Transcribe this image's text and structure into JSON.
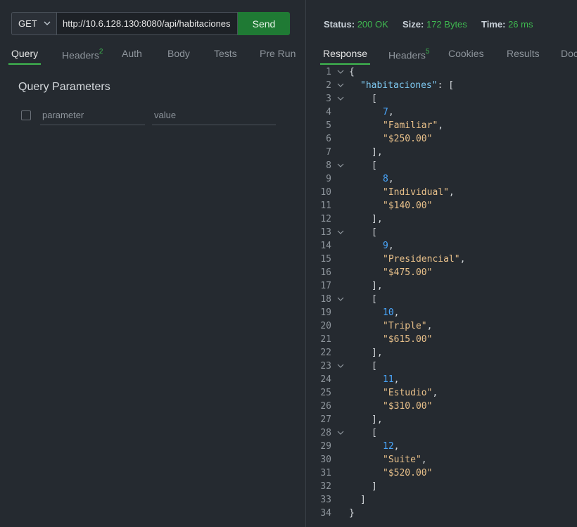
{
  "request": {
    "method": "GET",
    "url": "http://10.6.128.130:8080/api/habitaciones",
    "send_label": "Send"
  },
  "left_tabs": [
    {
      "label": "Query",
      "badge": ""
    },
    {
      "label": "Headers",
      "badge": "2"
    },
    {
      "label": "Auth",
      "badge": ""
    },
    {
      "label": "Body",
      "badge": ""
    },
    {
      "label": "Tests",
      "badge": ""
    },
    {
      "label": "Pre Run",
      "badge": ""
    }
  ],
  "query": {
    "title": "Query Parameters",
    "param_placeholder": "parameter",
    "value_placeholder": "value"
  },
  "status": {
    "status_label": "Status:",
    "status_value": "200 OK",
    "size_label": "Size:",
    "size_value": "172 Bytes",
    "time_label": "Time:",
    "time_value": "26 ms"
  },
  "right_tabs": [
    {
      "label": "Response",
      "badge": ""
    },
    {
      "label": "Headers",
      "badge": "5"
    },
    {
      "label": "Cookies",
      "badge": ""
    },
    {
      "label": "Results",
      "badge": ""
    },
    {
      "label": "Docs",
      "badge": ""
    }
  ],
  "response": {
    "key": "habitaciones",
    "rooms": [
      {
        "id": 7,
        "type": "Familiar",
        "price": "$250.00"
      },
      {
        "id": 8,
        "type": "Individual",
        "price": "$140.00"
      },
      {
        "id": 9,
        "type": "Presidencial",
        "price": "$475.00"
      },
      {
        "id": 10,
        "type": "Triple",
        "price": "$615.00"
      },
      {
        "id": 11,
        "type": "Estudio",
        "price": "$310.00"
      },
      {
        "id": 12,
        "type": "Suite",
        "price": "$520.00"
      }
    ]
  },
  "colors": {
    "accent_green": "#3fb950",
    "send_button": "#1f7a34",
    "json_key": "#7ec8f0",
    "json_number": "#4aa8ff",
    "json_string": "#e8c08a"
  }
}
